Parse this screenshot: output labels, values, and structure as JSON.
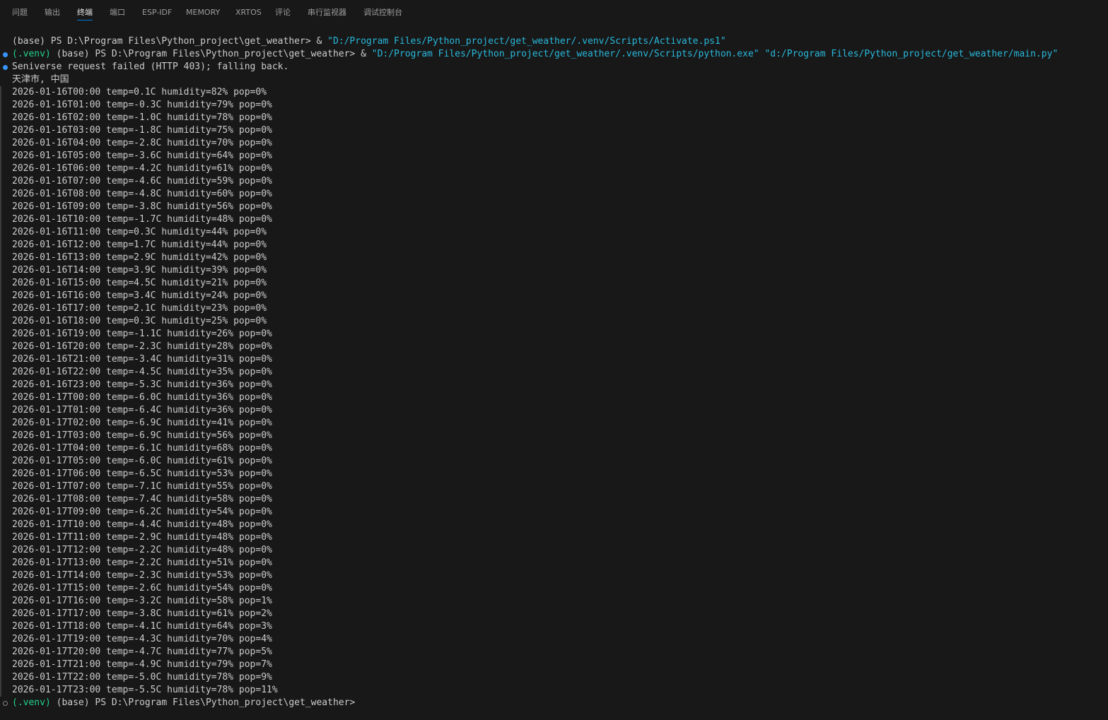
{
  "panel": {
    "tabs": [
      {
        "label": "问题"
      },
      {
        "label": "输出"
      },
      {
        "label": "终端"
      },
      {
        "label": "端口"
      },
      {
        "label": "ESP-IDF"
      },
      {
        "label": "MEMORY"
      },
      {
        "label": "XRTOS"
      },
      {
        "label": "评论"
      },
      {
        "label": "串行监视器"
      },
      {
        "label": "调试控制台"
      }
    ],
    "active_tab": "终端"
  },
  "colors": {
    "background": "#181818",
    "text": "#cccccc",
    "venv": "#23d18b",
    "string": "#29b8db",
    "active_tab_underline": "#0078d4",
    "decoration_blue": "#3794ff"
  },
  "terminal": {
    "cmd1": {
      "prefix": "(base) PS D:\\Program Files\\Python_project\\get_weather> & ",
      "path": "\"D:/Program Files/Python_project/get_weather/.venv/Scripts/Activate.ps1\""
    },
    "cmd2": {
      "venv": "(.venv)",
      "prefix": " (base) PS D:\\Program Files\\Python_project\\get_weather> & ",
      "exe": "\"D:/Program Files/Python_project/get_weather/.venv/Scripts/python.exe\"",
      "script": " \"d:/Program Files/Python_project/get_weather/main.py\""
    },
    "error_line": "Seniverse request failed (HTTP 403); falling back.",
    "location": "天津市, 中国",
    "rows": [
      "2026-01-16T00:00 temp=0.1C humidity=82% pop=0%",
      "2026-01-16T01:00 temp=-0.3C humidity=79% pop=0%",
      "2026-01-16T02:00 temp=-1.0C humidity=78% pop=0%",
      "2026-01-16T03:00 temp=-1.8C humidity=75% pop=0%",
      "2026-01-16T04:00 temp=-2.8C humidity=70% pop=0%",
      "2026-01-16T05:00 temp=-3.6C humidity=64% pop=0%",
      "2026-01-16T06:00 temp=-4.2C humidity=61% pop=0%",
      "2026-01-16T07:00 temp=-4.6C humidity=59% pop=0%",
      "2026-01-16T08:00 temp=-4.8C humidity=60% pop=0%",
      "2026-01-16T09:00 temp=-3.8C humidity=56% pop=0%",
      "2026-01-16T10:00 temp=-1.7C humidity=48% pop=0%",
      "2026-01-16T11:00 temp=0.3C humidity=44% pop=0%",
      "2026-01-16T12:00 temp=1.7C humidity=44% pop=0%",
      "2026-01-16T13:00 temp=2.9C humidity=42% pop=0%",
      "2026-01-16T14:00 temp=3.9C humidity=39% pop=0%",
      "2026-01-16T15:00 temp=4.5C humidity=21% pop=0%",
      "2026-01-16T16:00 temp=3.4C humidity=24% pop=0%",
      "2026-01-16T17:00 temp=2.1C humidity=23% pop=0%",
      "2026-01-16T18:00 temp=0.3C humidity=25% pop=0%",
      "2026-01-16T19:00 temp=-1.1C humidity=26% pop=0%",
      "2026-01-16T20:00 temp=-2.3C humidity=28% pop=0%",
      "2026-01-16T21:00 temp=-3.4C humidity=31% pop=0%",
      "2026-01-16T22:00 temp=-4.5C humidity=35% pop=0%",
      "2026-01-16T23:00 temp=-5.3C humidity=36% pop=0%",
      "2026-01-17T00:00 temp=-6.0C humidity=36% pop=0%",
      "2026-01-17T01:00 temp=-6.4C humidity=36% pop=0%",
      "2026-01-17T02:00 temp=-6.9C humidity=41% pop=0%",
      "2026-01-17T03:00 temp=-6.9C humidity=56% pop=0%",
      "2026-01-17T04:00 temp=-6.1C humidity=68% pop=0%",
      "2026-01-17T05:00 temp=-6.0C humidity=61% pop=0%",
      "2026-01-17T06:00 temp=-6.5C humidity=53% pop=0%",
      "2026-01-17T07:00 temp=-7.1C humidity=55% pop=0%",
      "2026-01-17T08:00 temp=-7.4C humidity=58% pop=0%",
      "2026-01-17T09:00 temp=-6.2C humidity=54% pop=0%",
      "2026-01-17T10:00 temp=-4.4C humidity=48% pop=0%",
      "2026-01-17T11:00 temp=-2.9C humidity=48% pop=0%",
      "2026-01-17T12:00 temp=-2.2C humidity=48% pop=0%",
      "2026-01-17T13:00 temp=-2.2C humidity=51% pop=0%",
      "2026-01-17T14:00 temp=-2.3C humidity=53% pop=0%",
      "2026-01-17T15:00 temp=-2.6C humidity=54% pop=0%",
      "2026-01-17T16:00 temp=-3.2C humidity=58% pop=1%",
      "2026-01-17T17:00 temp=-3.8C humidity=61% pop=2%",
      "2026-01-17T18:00 temp=-4.1C humidity=64% pop=3%",
      "2026-01-17T19:00 temp=-4.3C humidity=70% pop=4%",
      "2026-01-17T20:00 temp=-4.7C humidity=77% pop=5%",
      "2026-01-17T21:00 temp=-4.9C humidity=79% pop=7%",
      "2026-01-17T22:00 temp=-5.0C humidity=78% pop=9%",
      "2026-01-17T23:00 temp=-5.5C humidity=78% pop=11%"
    ],
    "final_prompt": {
      "venv": "(.venv)",
      "text": " (base) PS D:\\Program Files\\Python_project\\get_weather>"
    }
  }
}
